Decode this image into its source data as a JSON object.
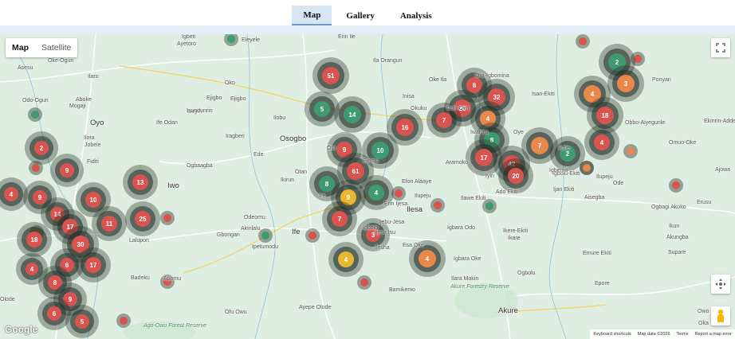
{
  "nav": {
    "tabs": [
      {
        "label": "Map",
        "active": true
      },
      {
        "label": "Gallery"
      },
      {
        "label": "Analysis"
      }
    ]
  },
  "map_controls": {
    "map_type": [
      "Map",
      "Satellite"
    ],
    "active_type": "Map",
    "fullscreen_icon": "fullscreen-icon",
    "camera_icon": "camera-control-icon",
    "pegman_icon": "street-view-pegman-icon"
  },
  "attribution": {
    "logo": "Google",
    "keyboard": "Keyboard shortcuts",
    "data": "Map data ©2026",
    "terms": "Terms",
    "report": "Report a map error"
  },
  "colors": {
    "red": "#d9534f",
    "green": "#3f9a72",
    "orange": "#e8884a",
    "yellow": "#e8b830",
    "halo": "#1f2a22"
  },
  "places": [
    {
      "t": "Igbeti"
    },
    {
      "t": "Ayetoro"
    },
    {
      "t": "Eleyele"
    },
    {
      "t": "Asesu"
    },
    {
      "t": "Odo-Ogun"
    },
    {
      "t": "Aboke"
    },
    {
      "t": "Mogaji"
    },
    {
      "t": "Oyo"
    },
    {
      "t": "Ilora"
    },
    {
      "t": "Jobele"
    },
    {
      "t": "Ejigbo"
    },
    {
      "t": "Iseyin"
    },
    {
      "t": "Fiditi"
    },
    {
      "t": "Iwo"
    },
    {
      "t": "Ogbaagba"
    },
    {
      "t": "Oko"
    },
    {
      "t": "Erin Ile"
    },
    {
      "t": "Ila Orangun"
    },
    {
      "t": "Oke Ila"
    },
    {
      "t": "Ora-Igbomina"
    },
    {
      "t": "Isan-Ekiti"
    },
    {
      "t": "Ponyan"
    },
    {
      "t": "Ekinrin-Adde"
    },
    {
      "t": "Obbo-Aiyegunle"
    },
    {
      "t": "Omuo-Oke"
    },
    {
      "t": "Ajowa"
    },
    {
      "t": "Ilupeju"
    },
    {
      "t": "Ode"
    },
    {
      "t": "Igbolu-Ekiti"
    },
    {
      "t": "Ijan Ekiti"
    },
    {
      "t": "Aisegba"
    },
    {
      "t": "Ogbagi Akoko"
    },
    {
      "t": "Erusu"
    },
    {
      "t": "Ikun"
    },
    {
      "t": "Akungba"
    },
    {
      "t": "Supare"
    },
    {
      "t": "Ikare"
    },
    {
      "t": "Ilesa"
    },
    {
      "t": "Igbara Odo"
    },
    {
      "t": "Ikere-Ekiti"
    },
    {
      "t": "Emure Ekiti"
    },
    {
      "t": "Igbara Oke"
    },
    {
      "t": "Ilara Mokin"
    },
    {
      "t": "Ogbolu"
    },
    {
      "t": "Akure Forestry Reserve"
    },
    {
      "t": "Bamikemo"
    },
    {
      "t": "Akure"
    },
    {
      "t": "Epore"
    },
    {
      "t": "Owo"
    },
    {
      "t": "Oka"
    },
    {
      "t": "Apomu"
    },
    {
      "t": "Badeku"
    },
    {
      "t": "Ife"
    },
    {
      "t": "Ipetumodu"
    },
    {
      "t": "Gbongan"
    },
    {
      "t": "Odeomu"
    },
    {
      "t": "Akinlalu"
    },
    {
      "t": "Olode"
    },
    {
      "t": "Ayepe Olode"
    },
    {
      "t": "Ofu Owu"
    },
    {
      "t": "Ago-Owu Forest Reserve"
    },
    {
      "t": "Oke-Ogun"
    },
    {
      "t": "Ilaro"
    },
    {
      "t": "Lalupon"
    },
    {
      "t": "Ilobu"
    },
    {
      "t": "Osogbo"
    },
    {
      "t": "Ede"
    },
    {
      "t": "Iragberi"
    },
    {
      "t": "Isundunrin"
    },
    {
      "t": "Ife Odan"
    },
    {
      "t": "Ejigbo"
    },
    {
      "t": "Ejemu"
    },
    {
      "t": "Ilawe Ekiti"
    },
    {
      "t": "Aramoko"
    },
    {
      "t": "Efon Alaaye"
    },
    {
      "t": "Erin Ijesa"
    },
    {
      "t": "Iyin"
    },
    {
      "t": "Igbemo"
    },
    {
      "t": "Ijesa Isu"
    },
    {
      "t": "Ado Ekiti"
    },
    {
      "t": "Oye"
    },
    {
      "t": "Ikole"
    },
    {
      "t": "Ilupeju"
    },
    {
      "t": "Iwaraja"
    },
    {
      "t": "Odo-Otin"
    },
    {
      "t": "Ota"
    },
    {
      "t": "Esa Oke"
    },
    {
      "t": "Ilesha"
    },
    {
      "t": "Igbajo"
    },
    {
      "t": "Otan"
    },
    {
      "t": "Ire"
    },
    {
      "t": "Ikirun"
    },
    {
      "t": "Inisa"
    },
    {
      "t": "Okuku"
    },
    {
      "t": "Ijebu-Jesa"
    }
  ],
  "clusters": [
    {
      "color": "red",
      "label": "2",
      "r": 9
    },
    {
      "color": "red",
      "label": "9",
      "r": 9
    },
    {
      "color": "red",
      "label": "4",
      "r": 9
    },
    {
      "color": "red",
      "label": "9",
      "r": 9
    },
    {
      "color": "red",
      "label": "10",
      "r": 10
    },
    {
      "color": "red",
      "label": "13",
      "r": 10
    },
    {
      "color": "red",
      "label": "14",
      "r": 9
    },
    {
      "color": "red",
      "label": "11",
      "r": 10
    },
    {
      "color": "red",
      "label": "25",
      "r": 10
    },
    {
      "color": "red",
      "label": "17",
      "r": 10
    },
    {
      "color": "red",
      "label": "18",
      "r": 10
    },
    {
      "color": "red",
      "label": "30",
      "r": 11
    },
    {
      "color": "red",
      "label": "6",
      "r": 9
    },
    {
      "color": "red",
      "label": "17",
      "r": 10
    },
    {
      "color": "red",
      "label": "8",
      "r": 9
    },
    {
      "color": "red",
      "label": "9",
      "r": 9
    },
    {
      "color": "red",
      "label": "6",
      "r": 9
    },
    {
      "color": "red",
      "label": "5",
      "r": 9
    },
    {
      "color": "red",
      "label": "4",
      "r": 8
    },
    {
      "color": "red",
      "label": "51",
      "r": 11
    },
    {
      "color": "green",
      "label": "5",
      "r": 10
    },
    {
      "color": "green",
      "label": "14",
      "r": 11
    },
    {
      "color": "red",
      "label": "16",
      "r": 11
    },
    {
      "color": "red",
      "label": "9",
      "r": 10
    },
    {
      "color": "green",
      "label": "10",
      "r": 11
    },
    {
      "color": "red",
      "label": "61",
      "r": 11
    },
    {
      "color": "green",
      "label": "8",
      "r": 10
    },
    {
      "color": "yellow",
      "label": "9",
      "r": 10
    },
    {
      "color": "green",
      "label": "4",
      "r": 10
    },
    {
      "color": "red",
      "label": "7",
      "r": 10
    },
    {
      "color": "red",
      "label": "3",
      "r": 9
    },
    {
      "color": "yellow",
      "label": "4",
      "r": 10
    },
    {
      "color": "orange",
      "label": "4",
      "r": 11
    },
    {
      "color": "red",
      "label": "8",
      "r": 10
    },
    {
      "color": "red",
      "label": "20",
      "r": 11
    },
    {
      "color": "red",
      "label": "32",
      "r": 11
    },
    {
      "color": "red",
      "label": "7",
      "r": 10
    },
    {
      "color": "orange",
      "label": "4",
      "r": 10
    },
    {
      "color": "green",
      "label": "8",
      "r": 10
    },
    {
      "color": "orange",
      "label": "7",
      "r": 11
    },
    {
      "color": "green",
      "label": "2",
      "r": 10
    },
    {
      "color": "red",
      "label": "17",
      "r": 11
    },
    {
      "color": "red",
      "label": "42",
      "r": 11
    },
    {
      "color": "red",
      "label": "20",
      "r": 10
    },
    {
      "color": "orange",
      "label": "4",
      "r": 11
    },
    {
      "color": "green",
      "label": "2",
      "r": 11
    },
    {
      "color": "orange",
      "label": "3",
      "r": 11
    },
    {
      "color": "red",
      "label": "18",
      "r": 11
    },
    {
      "color": "red",
      "label": "4",
      "r": 10
    }
  ],
  "singles": [
    {
      "color": "green"
    },
    {
      "color": "red"
    },
    {
      "color": "green"
    },
    {
      "color": "red"
    },
    {
      "color": "orange"
    },
    {
      "color": "red"
    },
    {
      "color": "red"
    },
    {
      "color": "orange"
    },
    {
      "color": "red"
    },
    {
      "color": "green"
    },
    {
      "color": "red"
    },
    {
      "color": "red"
    },
    {
      "color": "green"
    },
    {
      "color": "red"
    },
    {
      "color": "red"
    },
    {
      "color": "red"
    },
    {
      "color": "orange"
    },
    {
      "color": "red"
    },
    {
      "color": "red"
    }
  ]
}
